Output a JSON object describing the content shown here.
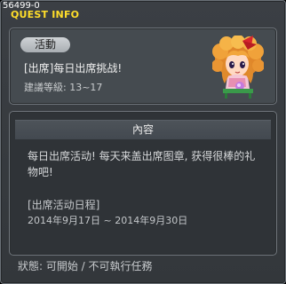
{
  "window": {
    "id": "56499-0",
    "title": "QUEST INFO"
  },
  "quest": {
    "category": "活動",
    "name": "[出席]每日出席挑战!",
    "level": "建議等級: 13~17"
  },
  "content": {
    "header": "內容",
    "description": "每日出席活动! 每天来盖出席图章, 获得很棒的礼物吧!",
    "schedule_label": "[出席活动日程]",
    "schedule_dates": "2014年9月17日 ~ 2014年9月30日"
  },
  "status": {
    "text": "狀態: 可開始 / 不可執行任務"
  },
  "icons": {
    "npc": "npc-girl-portrait-icon"
  }
}
